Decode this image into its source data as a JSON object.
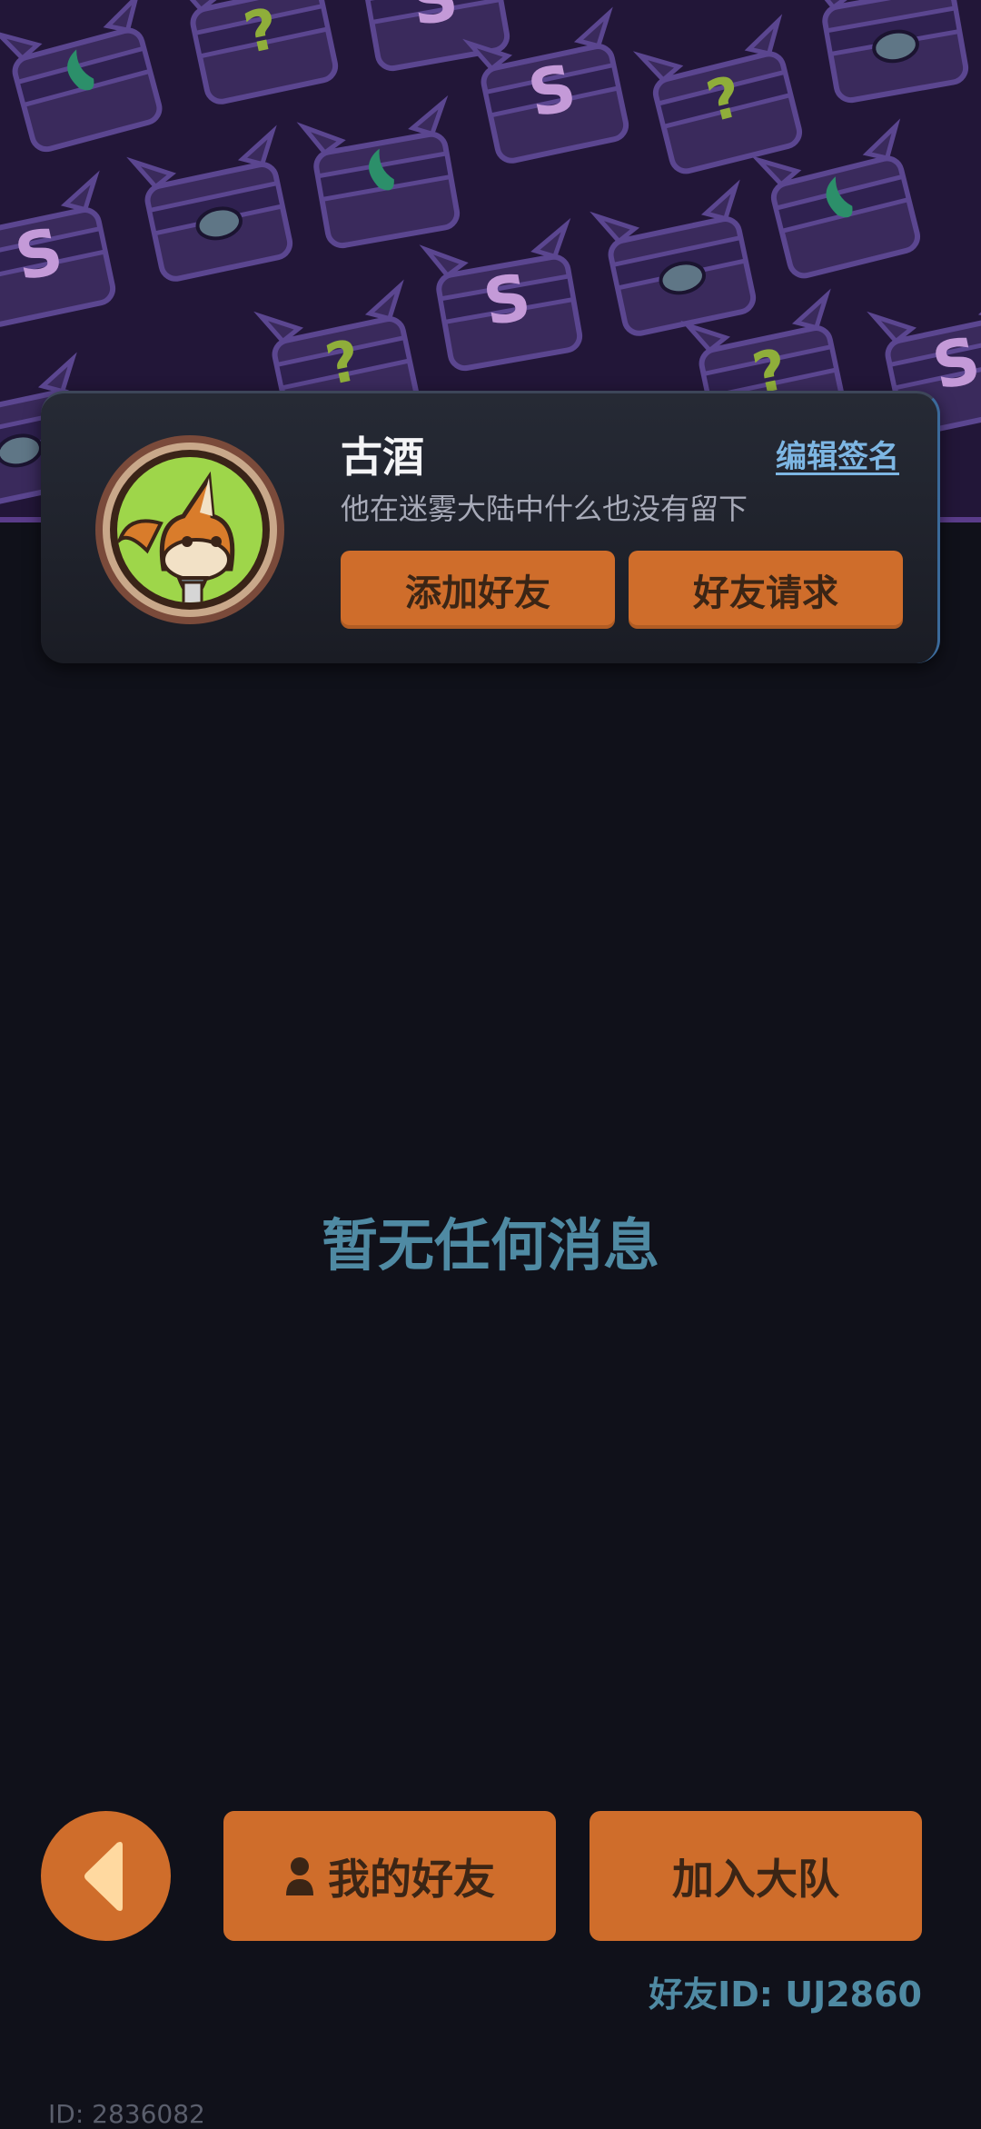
{
  "profile": {
    "username": "古酒",
    "edit_signature_label": "编辑签名",
    "signature": "他在迷雾大陆中什么也没有留下",
    "add_friend_label": "添加好友",
    "friend_requests_label": "好友请求"
  },
  "messages": {
    "empty_text": "暂无任何消息"
  },
  "bottom_bar": {
    "my_friends_label": "我的好友",
    "join_team_label": "加入大队",
    "friend_id_text": "好友ID: UJ2860"
  },
  "footer": {
    "user_id_text": "ID: 2836082"
  },
  "colors": {
    "background": "#10111a",
    "accent_orange": "#cf6d2b",
    "banner_purple": "#221638",
    "muted_blue": "#4f8aa3",
    "link_blue": "#7db6e3"
  },
  "icons": {
    "back": "triangle-left-icon",
    "friends": "person-icon"
  }
}
